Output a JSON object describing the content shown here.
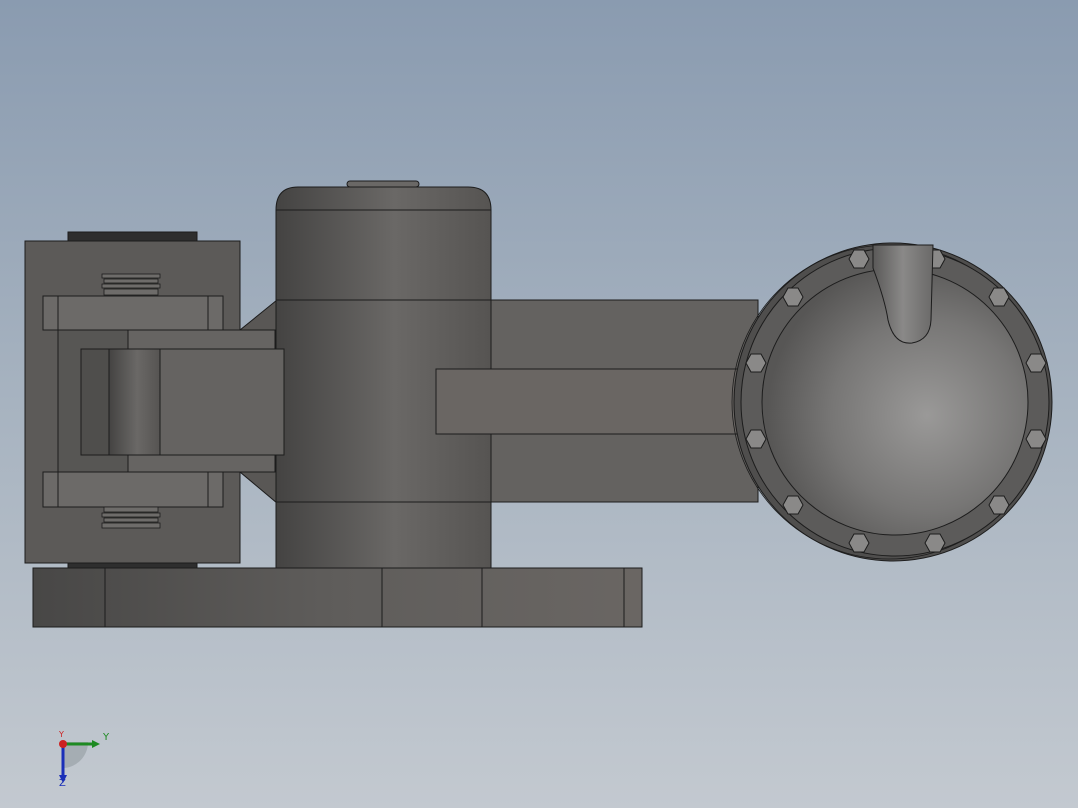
{
  "viewport": {
    "background_top": "#8a9bb0",
    "background_bottom": "#c3c9d0"
  },
  "model": {
    "body_color": "#5e5c5a",
    "edge_color": "#1c1c1c"
  },
  "triad": {
    "x_label": "Y",
    "y_label": "Y",
    "z_label": "Z",
    "x_color": "#1e8a22",
    "y_color": "#cc2222",
    "z_color": "#1a2fb8"
  }
}
